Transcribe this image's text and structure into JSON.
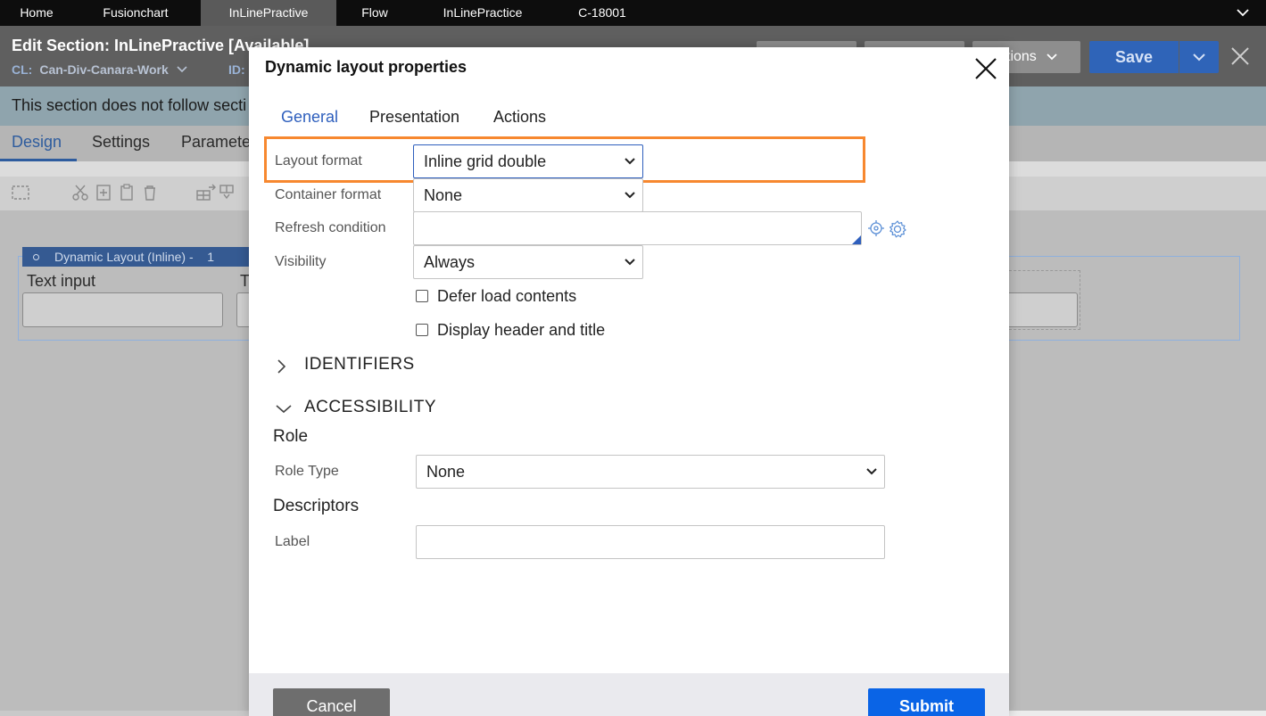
{
  "top_tabs": [
    "Home",
    "Fusionchart",
    "InLinePractive",
    "Flow",
    "InLinePractice",
    "C-18001"
  ],
  "header": {
    "title": "Edit  Section: InLinePractive [Available]",
    "cl_label": "CL:",
    "cl_value": "Can-Div-Canara-Work",
    "id_label": "ID:",
    "actions_label": "tions",
    "save_label": "Save"
  },
  "info_bar": "This section does not follow secti",
  "section_tabs": [
    "Design",
    "Settings",
    "Paramete"
  ],
  "canvas": {
    "layout_header": "Dynamic Layout (Inline) -",
    "layout_index": "1",
    "cell1_label": "Text input",
    "cell2_label": "T"
  },
  "modal": {
    "title": "Dynamic layout properties",
    "tabs": [
      "General",
      "Presentation",
      "Actions"
    ],
    "fields": {
      "layout_format": {
        "label": "Layout format",
        "value": "Inline grid double"
      },
      "container_format": {
        "label": "Container format",
        "value": "None"
      },
      "refresh_condition": {
        "label": "Refresh condition"
      },
      "visibility": {
        "label": "Visibility",
        "value": "Always"
      }
    },
    "checkboxes": {
      "defer_load": "Defer load contents",
      "display_header": "Display header and title"
    },
    "sections": {
      "identifiers": "IDENTIFIERS",
      "accessibility": "ACCESSIBILITY"
    },
    "role": {
      "heading": "Role",
      "role_type_label": "Role Type",
      "role_type_value": "None"
    },
    "descriptors": {
      "heading": "Descriptors",
      "label_label": "Label"
    },
    "buttons": {
      "cancel": "Cancel",
      "submit": "Submit"
    }
  },
  "colors": {
    "accent_blue": "#2e5fbd",
    "highlight_orange": "#f7882f",
    "submit_blue": "#0a64e6"
  }
}
